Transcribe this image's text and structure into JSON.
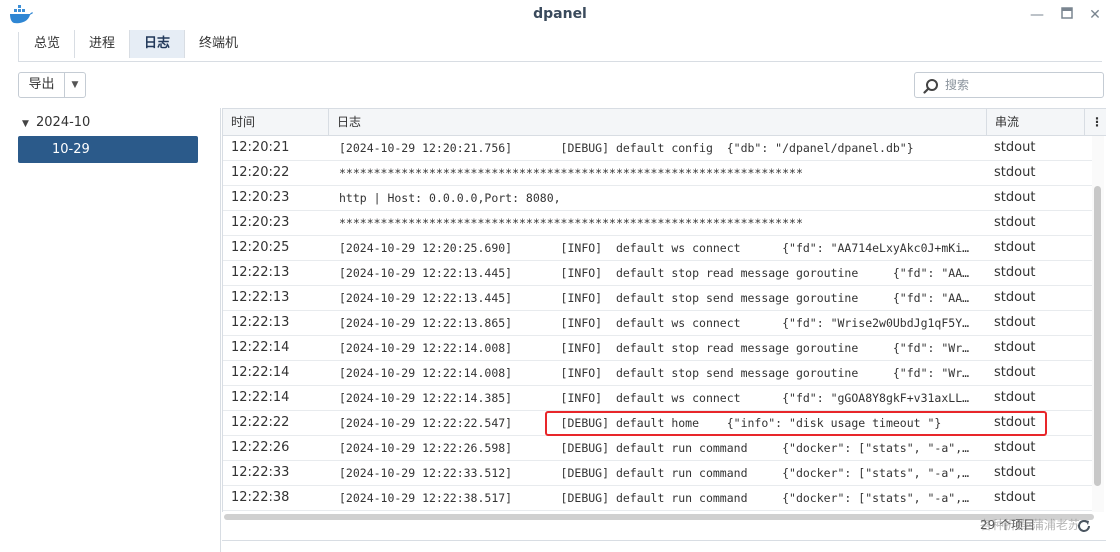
{
  "window": {
    "title": "dpanel",
    "icon": "docker-whale-icon"
  },
  "tabs": [
    {
      "label": "总览",
      "active": false
    },
    {
      "label": "进程",
      "active": false
    },
    {
      "label": "日志",
      "active": true
    },
    {
      "label": "终端机",
      "active": false
    }
  ],
  "toolbar": {
    "export_label": "导出",
    "export_caret": "▼"
  },
  "search": {
    "placeholder": "搜索",
    "value": ""
  },
  "sidebar": {
    "group_label": "2024-10",
    "selected_item": "10-29"
  },
  "grid": {
    "headers": {
      "time": "时间",
      "log": "日志",
      "stream": "串流"
    },
    "rows": [
      {
        "time": "12:20:21",
        "log": "[2024-10-29 12:20:21.756]       [DEBUG] default config  {\"db\": \"/dpanel/dpanel.db\"}",
        "stream": "stdout"
      },
      {
        "time": "12:20:22",
        "log": "*******************************************************************",
        "stream": "stdout"
      },
      {
        "time": "12:20:23",
        "log": "http | Host: 0.0.0.0,Port: 8080,",
        "stream": "stdout"
      },
      {
        "time": "12:20:23",
        "log": "*******************************************************************",
        "stream": "stdout"
      },
      {
        "time": "12:20:25",
        "log": "[2024-10-29 12:20:25.690]       [INFO]  default ws connect      {\"fd\": \"AA714eLxyAkc0J+mKi…",
        "stream": "stdout"
      },
      {
        "time": "12:22:13",
        "log": "[2024-10-29 12:22:13.445]       [INFO]  default stop read message goroutine     {\"fd\": \"AA…",
        "stream": "stdout"
      },
      {
        "time": "12:22:13",
        "log": "[2024-10-29 12:22:13.445]       [INFO]  default stop send message goroutine     {\"fd\": \"AA…",
        "stream": "stdout"
      },
      {
        "time": "12:22:13",
        "log": "[2024-10-29 12:22:13.865]       [INFO]  default ws connect      {\"fd\": \"Wrise2w0UbdJg1qF5Y…",
        "stream": "stdout"
      },
      {
        "time": "12:22:14",
        "log": "[2024-10-29 12:22:14.008]       [INFO]  default stop read message goroutine     {\"fd\": \"Wr…",
        "stream": "stdout"
      },
      {
        "time": "12:22:14",
        "log": "[2024-10-29 12:22:14.008]       [INFO]  default stop send message goroutine     {\"fd\": \"Wr…",
        "stream": "stdout"
      },
      {
        "time": "12:22:14",
        "log": "[2024-10-29 12:22:14.385]       [INFO]  default ws connect      {\"fd\": \"gGOA8Y8gkF+v31axLL…",
        "stream": "stdout"
      },
      {
        "time": "12:22:22",
        "log": "[2024-10-29 12:22:22.547]       [DEBUG] default home    {\"info\": \"disk usage timeout \"}",
        "stream": "stdout",
        "highlighted": true
      },
      {
        "time": "12:22:26",
        "log": "[2024-10-29 12:22:26.598]       [DEBUG] default run command     {\"docker\": [\"stats\", \"-a\",…",
        "stream": "stdout"
      },
      {
        "time": "12:22:33",
        "log": "[2024-10-29 12:22:33.512]       [DEBUG] default run command     {\"docker\": [\"stats\", \"-a\",…",
        "stream": "stdout"
      },
      {
        "time": "12:22:38",
        "log": "[2024-10-29 12:22:38.517]       [DEBUG] default run command     {\"docker\": [\"stats\", \"-a\",…",
        "stream": "stdout"
      }
    ]
  },
  "footer": {
    "count_text": "29 个项目",
    "watermark": "各种折腾·蒲浦老苏"
  },
  "colors": {
    "accent": "#2b5a8a",
    "highlight_border": "#e8262a"
  }
}
